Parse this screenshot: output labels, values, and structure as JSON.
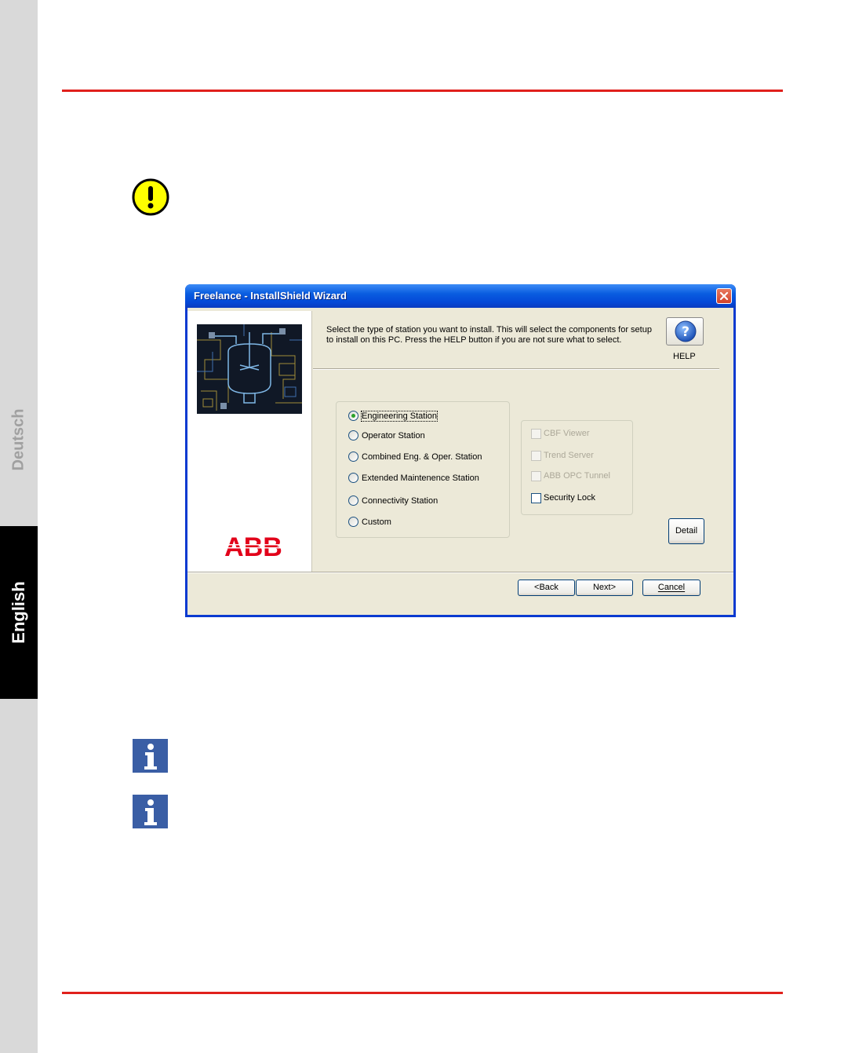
{
  "side_tabs": {
    "deutsch": "Deutsch",
    "english": "English"
  },
  "colors": {
    "rule": "#e0201c",
    "titlebar": "#0a5de0",
    "dialog_bg": "#ece9d8",
    "info_icon": "#3a5ea5",
    "warning_icon": "#ffff00",
    "abb_red": "#e2001a"
  },
  "icons": {
    "warning": "warning-exclamation-icon",
    "info": "info-icon",
    "help": "help-question-icon",
    "close": "close-icon"
  },
  "dialog": {
    "title": "Freelance - InstallShield Wizard",
    "intro_line1": "Select the type of station you want to install. This will select the components for setup",
    "intro_line2": "to install on this PC. Press the HELP button if you are not sure what to select.",
    "help_label": "HELP",
    "logo_text": "ABB",
    "station_types": [
      {
        "label": "Engineering Station",
        "selected": true
      },
      {
        "label": "Operator Station",
        "selected": false
      },
      {
        "label": "Combined Eng. & Oper. Station",
        "selected": false
      },
      {
        "label": "Extended Maintenence Station",
        "selected": false
      },
      {
        "label": "Connectivity Station",
        "selected": false
      },
      {
        "label": "Custom",
        "selected": false
      }
    ],
    "components": [
      {
        "label": "CBF Viewer",
        "enabled": false,
        "checked": false
      },
      {
        "label": "Trend Server",
        "enabled": false,
        "checked": false
      },
      {
        "label": "ABB OPC Tunnel",
        "enabled": false,
        "checked": false
      },
      {
        "label": "Security Lock",
        "enabled": true,
        "checked": false
      }
    ],
    "detail_label": "Detail",
    "back_label": "<Back",
    "next_label": "Next>",
    "cancel_label": "Cancel"
  }
}
